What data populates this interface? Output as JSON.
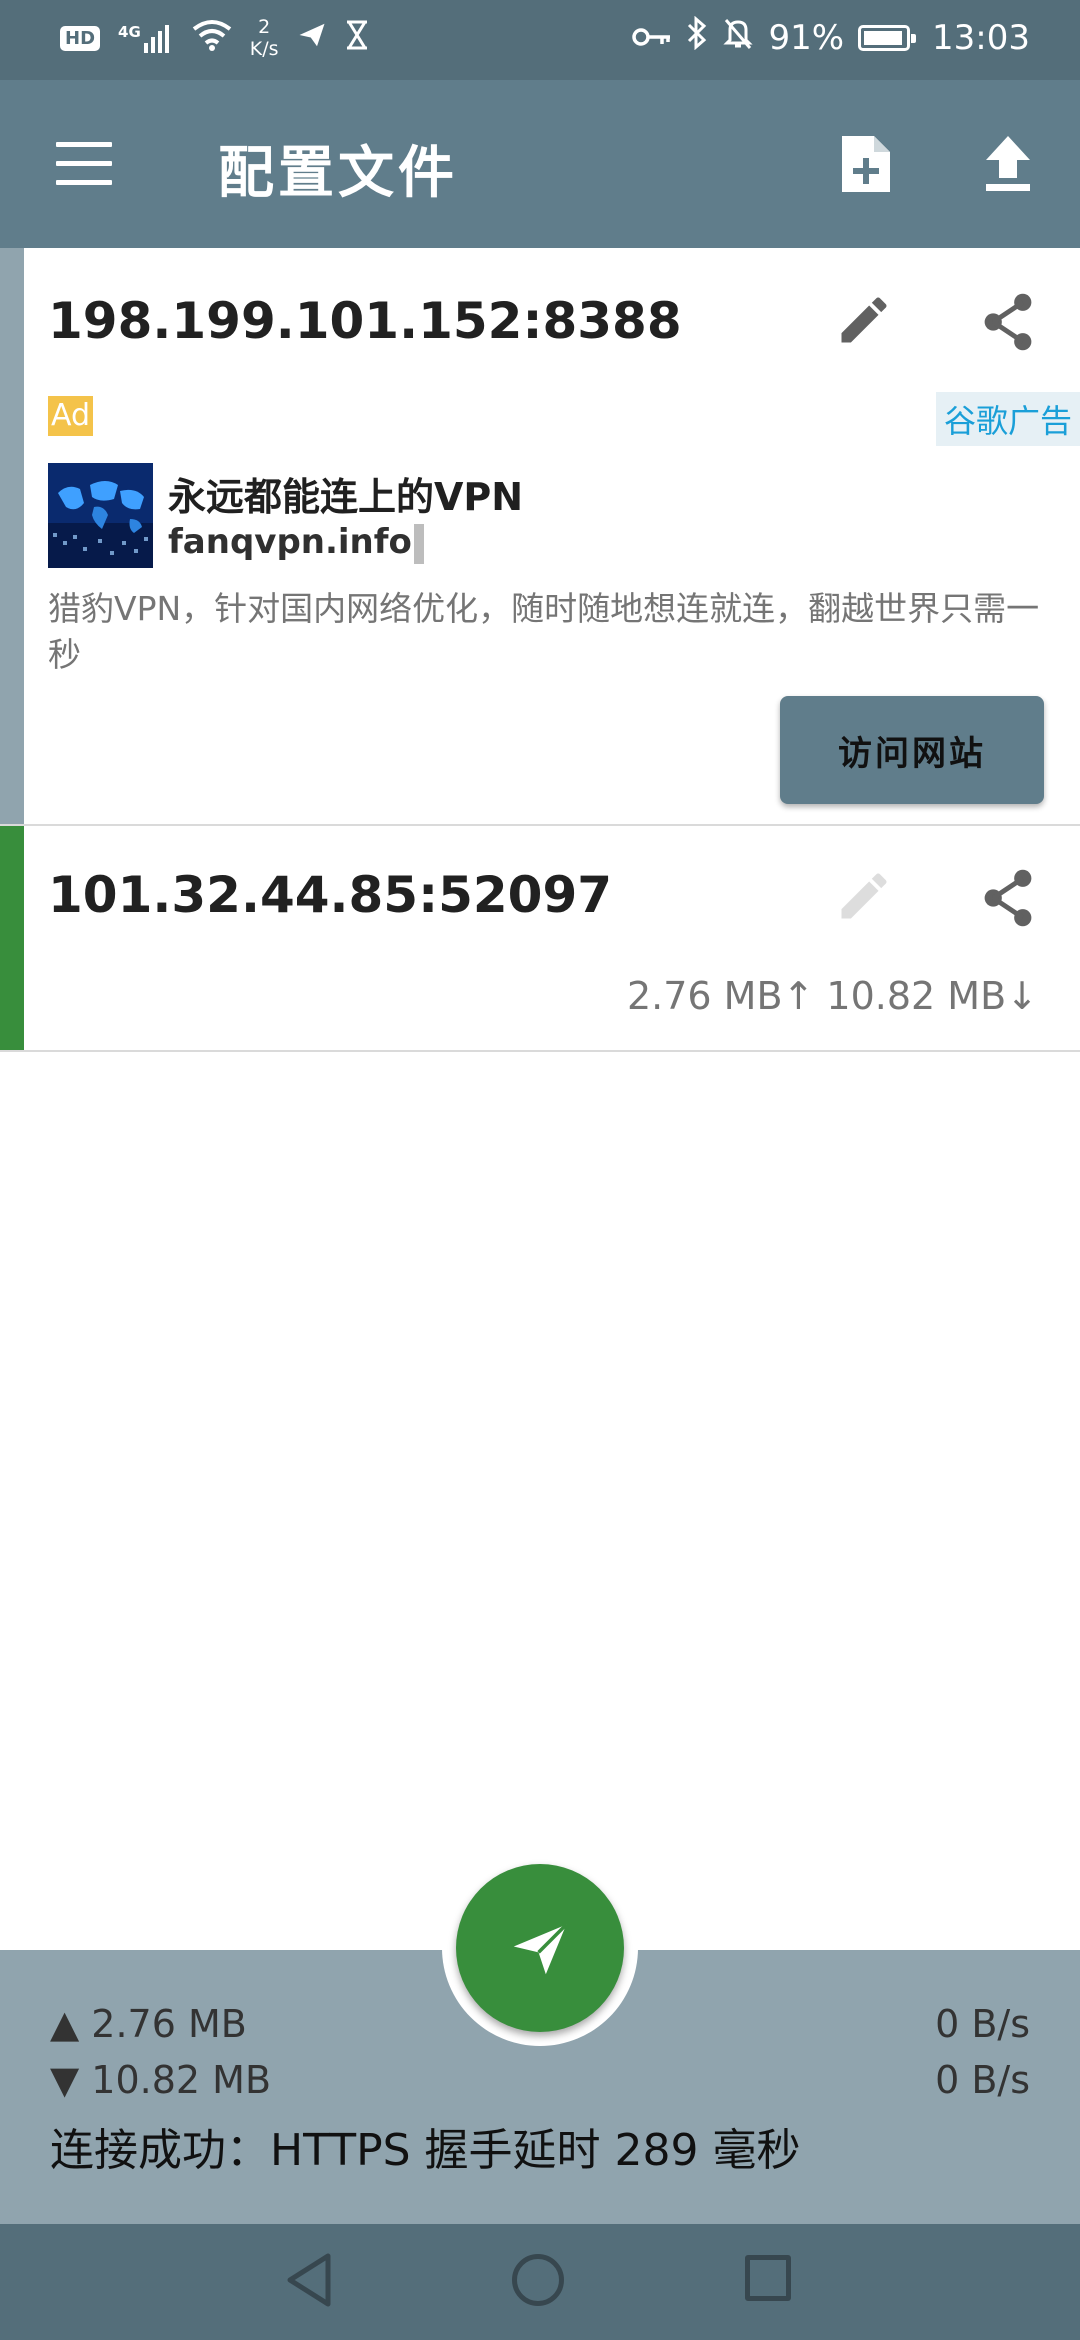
{
  "status_bar": {
    "hd": "HD",
    "network": "4G",
    "speed_value": "2",
    "speed_unit": "K/s",
    "battery": "91%",
    "time": "13:03"
  },
  "app_bar": {
    "title": "配置文件"
  },
  "profiles": [
    {
      "name": "198.199.101.152:8388",
      "strip_color": "#90a4ae"
    },
    {
      "name": "101.32.44.85:52097",
      "strip_color": "#388e3c",
      "traffic": "2.76 MB↑ 10.82 MB↓"
    }
  ],
  "ad": {
    "badge": "Ad",
    "source": "谷歌广告",
    "title": "永远都能连上的VPN",
    "url": "fanqvpn.info",
    "description": "猎豹VPN，针对国内网络优化，随时随地想连就连，翻越世界只需一秒",
    "button": "访问网站"
  },
  "stats": {
    "upload_total": "▲ 2.76 MB",
    "download_total": "▼ 10.82 MB",
    "upload_rate": "0 B/s",
    "download_rate": "0 B/s",
    "status": "连接成功：HTTPS 握手延时 289 毫秒"
  },
  "icons": {
    "menu": "menu-icon",
    "add_file": "add-file-icon",
    "upload": "upload-icon",
    "edit": "pencil-icon",
    "share": "share-icon",
    "fab": "paper-plane-icon"
  },
  "colors": {
    "status_bar": "#546e7a",
    "app_bar": "#607d8b",
    "connected": "#388e3c",
    "bottom_panel": "#90a4ae",
    "ad_link": "#1a9fd8"
  }
}
